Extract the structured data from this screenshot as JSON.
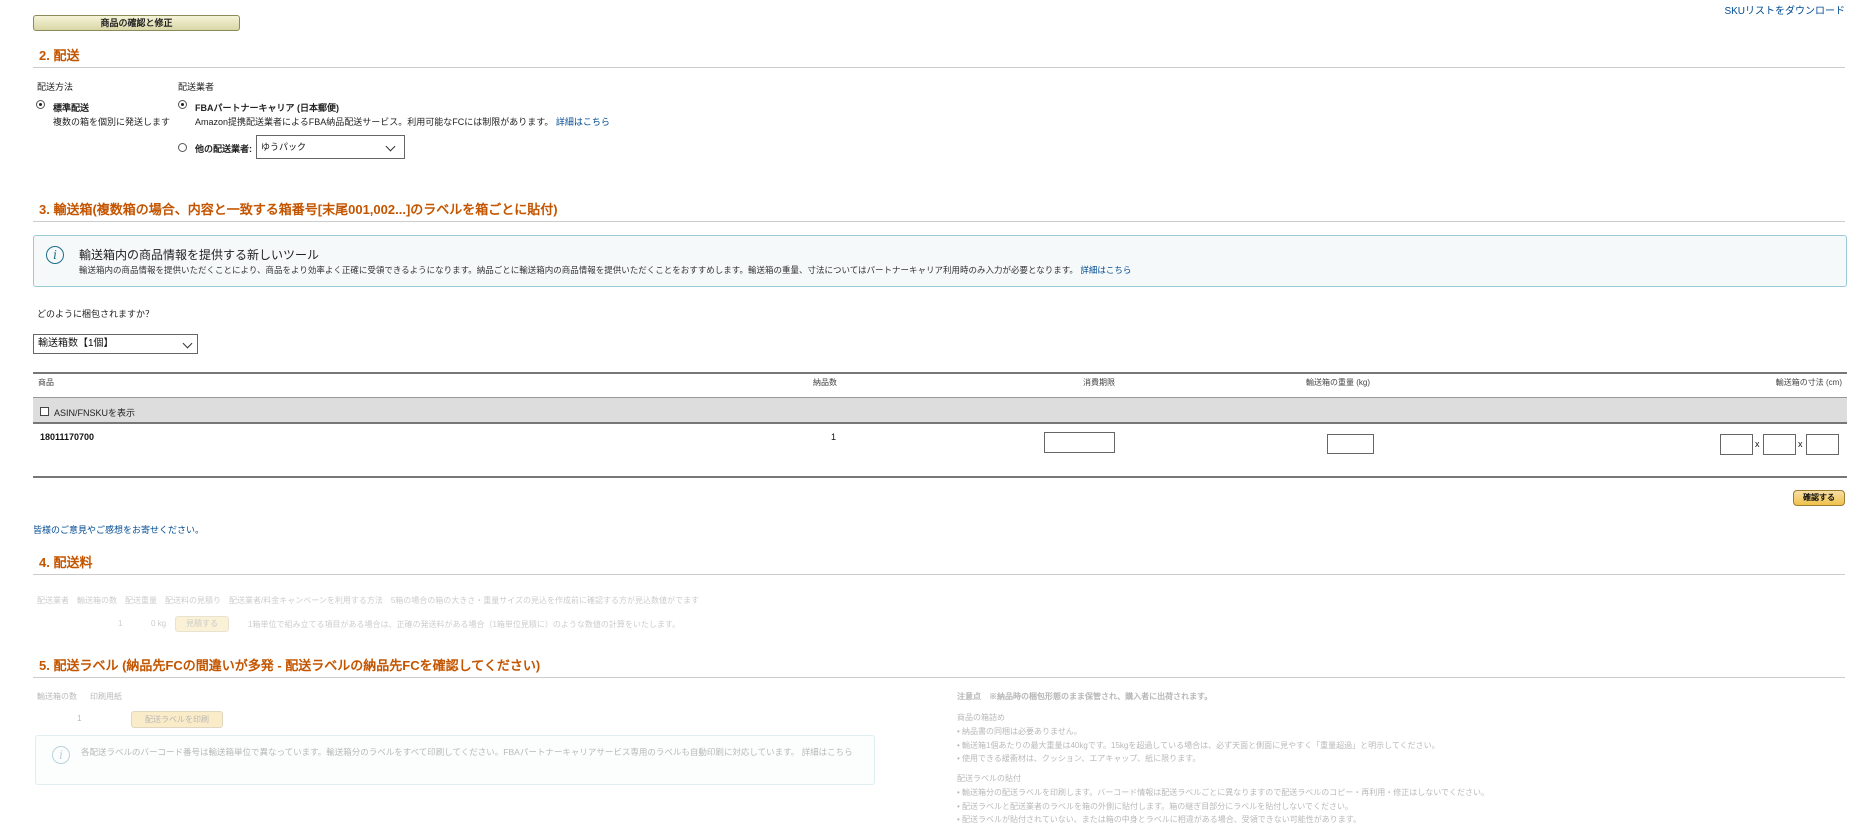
{
  "top": {
    "confirm_button": "商品の確認と修正",
    "sku_link": "SKUリストをダウンロード"
  },
  "section2": {
    "title": "2. 配送",
    "method_label": "配送方法",
    "method_option": "標準配送",
    "method_desc": "複数の箱を個別に発送します",
    "carrier_label": "配送業者",
    "partner_option": "FBAパートナーキャリア (日本郵便)",
    "partner_desc": "Amazon提携配送業者によるFBA納品配送サービス。利用可能なFCには制限があります。",
    "partner_link": "詳細はこちら",
    "other_option": "他の配送業者:",
    "other_select_value": "ゆうパック"
  },
  "section3": {
    "title": "3. 輸送箱(複数箱の場合、内容と一致する箱番号[末尾001,002...]のラベルを箱ごとに貼付)",
    "info_title": "輸送箱内の商品情報を提供する新しいツール",
    "info_text": "輸送箱内の商品情報を提供いただくことにより、商品をより効率よく正確に受領できるようになります。納品ごとに輸送箱内の商品情報を提供いただくことをおすすめします。輸送箱の重量、寸法についてはパートナーキャリア利用時のみ入力が必要となります。",
    "info_link": "詳細はこちら",
    "question": "どのように梱包されますか？",
    "pack_select_value": "輸送箱数【1個】",
    "columns": [
      "商品",
      "納品数",
      "消費期限",
      "輸送箱の重量 (kg)",
      "輸送箱の寸法 (cm)"
    ],
    "show_asin_label": "ASIN/FNSKUを表示",
    "row": {
      "sku": "18011170700",
      "qty": "1"
    },
    "dim_sep": "x",
    "confirm_button": "確認する",
    "feedback_link": "皆様のご意見やご感想をお寄せください。"
  },
  "section4": {
    "title": "4. 配送料",
    "header_text": "配送業者　輸送箱の数　配送重量　配送料の見積り　配送業者/料金キャンペーンを利用する方法　5箱の場合の箱の大きさ・重量サイズの見込を作成前に確認する方が見込数値がでます",
    "row_count": "1",
    "row_weight": "0 kg",
    "row_button": "見積する",
    "row_note": "1箱単位で組み立てる項目がある場合は、正確の発送料がある場合（1箱単位見積に）のような数値の計算をいたします。"
  },
  "section5": {
    "title": "5. 配送ラベル (納品先FCの間違いが多発 - 配送ラベルの納品先FCを確認してください)",
    "col_count_label": "輸送箱の数",
    "col_paper_label": "印刷用紙",
    "box_count": "1",
    "print_button": "配送ラベルを印刷",
    "info_text": "各配送ラベルのバーコード番号は輸送箱単位で異なっています。輸送箱分のラベルをすべて印刷してください。FBAパートナーキャリアサービス専用のラベルも自動印刷に対応しています。 詳細はこちら",
    "notes_title": "注意点　※納品時の梱包形態のまま保管され、購入者に出荷されます。",
    "packing_heading": "商品の箱詰め",
    "packing_items": [
      "納品書の同梱は必要ありません。",
      "輸送箱1個あたりの最大重量は40kgです。15kgを超過している場合は、必ず天面と側面に見やすく「重量超過」と明示してください。",
      "使用できる緩衝材は、クッション、エアキャップ、紙に限ります。"
    ],
    "label_heading": "配送ラベルの貼付",
    "label_items": [
      "輸送箱分の配送ラベルを印刷します。バーコード情報は配送ラベルごとに異なりますので配送ラベルのコピー・再利用・修正はしないでください。",
      "配送ラベルと配送業者のラベルを箱の外側に貼付します。箱の継ぎ目部分にラベルを貼付しないでください。",
      "配送ラベルが貼付されていない、または箱の中身とラベルに相違がある場合、受領できない可能性があります。"
    ]
  }
}
